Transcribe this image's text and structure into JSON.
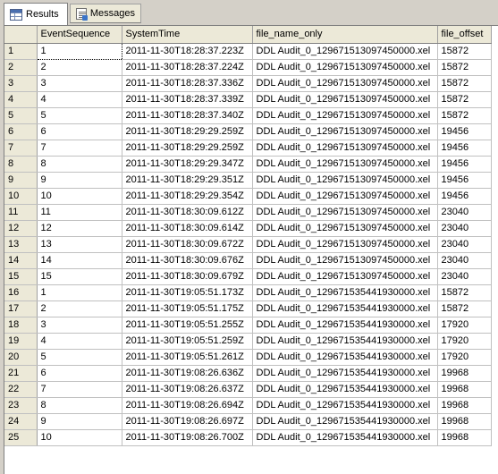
{
  "tabs": [
    {
      "label": "Results",
      "icon": "results-grid-icon",
      "active": true
    },
    {
      "label": "Messages",
      "icon": "messages-icon",
      "active": false
    }
  ],
  "grid": {
    "columns": [
      "EventSequence",
      "SystemTime",
      "file_name_only",
      "file_offset"
    ],
    "rows": [
      [
        "1",
        "1",
        "2011-11-30T18:28:37.223Z",
        "DDL Audit_0_129671513097450000.xel",
        "15872"
      ],
      [
        "2",
        "2",
        "2011-11-30T18:28:37.224Z",
        "DDL Audit_0_129671513097450000.xel",
        "15872"
      ],
      [
        "3",
        "3",
        "2011-11-30T18:28:37.336Z",
        "DDL Audit_0_129671513097450000.xel",
        "15872"
      ],
      [
        "4",
        "4",
        "2011-11-30T18:28:37.339Z",
        "DDL Audit_0_129671513097450000.xel",
        "15872"
      ],
      [
        "5",
        "5",
        "2011-11-30T18:28:37.340Z",
        "DDL Audit_0_129671513097450000.xel",
        "15872"
      ],
      [
        "6",
        "6",
        "2011-11-30T18:29:29.259Z",
        "DDL Audit_0_129671513097450000.xel",
        "19456"
      ],
      [
        "7",
        "7",
        "2011-11-30T18:29:29.259Z",
        "DDL Audit_0_129671513097450000.xel",
        "19456"
      ],
      [
        "8",
        "8",
        "2011-11-30T18:29:29.347Z",
        "DDL Audit_0_129671513097450000.xel",
        "19456"
      ],
      [
        "9",
        "9",
        "2011-11-30T18:29:29.351Z",
        "DDL Audit_0_129671513097450000.xel",
        "19456"
      ],
      [
        "10",
        "10",
        "2011-11-30T18:29:29.354Z",
        "DDL Audit_0_129671513097450000.xel",
        "19456"
      ],
      [
        "11",
        "11",
        "2011-11-30T18:30:09.612Z",
        "DDL Audit_0_129671513097450000.xel",
        "23040"
      ],
      [
        "12",
        "12",
        "2011-11-30T18:30:09.614Z",
        "DDL Audit_0_129671513097450000.xel",
        "23040"
      ],
      [
        "13",
        "13",
        "2011-11-30T18:30:09.672Z",
        "DDL Audit_0_129671513097450000.xel",
        "23040"
      ],
      [
        "14",
        "14",
        "2011-11-30T18:30:09.676Z",
        "DDL Audit_0_129671513097450000.xel",
        "23040"
      ],
      [
        "15",
        "15",
        "2011-11-30T18:30:09.679Z",
        "DDL Audit_0_129671513097450000.xel",
        "23040"
      ],
      [
        "16",
        "1",
        "2011-11-30T19:05:51.173Z",
        "DDL Audit_0_129671535441930000.xel",
        "15872"
      ],
      [
        "17",
        "2",
        "2011-11-30T19:05:51.175Z",
        "DDL Audit_0_129671535441930000.xel",
        "15872"
      ],
      [
        "18",
        "3",
        "2011-11-30T19:05:51.255Z",
        "DDL Audit_0_129671535441930000.xel",
        "17920"
      ],
      [
        "19",
        "4",
        "2011-11-30T19:05:51.259Z",
        "DDL Audit_0_129671535441930000.xel",
        "17920"
      ],
      [
        "20",
        "5",
        "2011-11-30T19:05:51.261Z",
        "DDL Audit_0_129671535441930000.xel",
        "17920"
      ],
      [
        "21",
        "6",
        "2011-11-30T19:08:26.636Z",
        "DDL Audit_0_129671535441930000.xel",
        "19968"
      ],
      [
        "22",
        "7",
        "2011-11-30T19:08:26.637Z",
        "DDL Audit_0_129671535441930000.xel",
        "19968"
      ],
      [
        "23",
        "8",
        "2011-11-30T19:08:26.694Z",
        "DDL Audit_0_129671535441930000.xel",
        "19968"
      ],
      [
        "24",
        "9",
        "2011-11-30T19:08:26.697Z",
        "DDL Audit_0_129671535441930000.xel",
        "19968"
      ],
      [
        "25",
        "10",
        "2011-11-30T19:08:26.700Z",
        "DDL Audit_0_129671535441930000.xel",
        "19968"
      ]
    ]
  }
}
